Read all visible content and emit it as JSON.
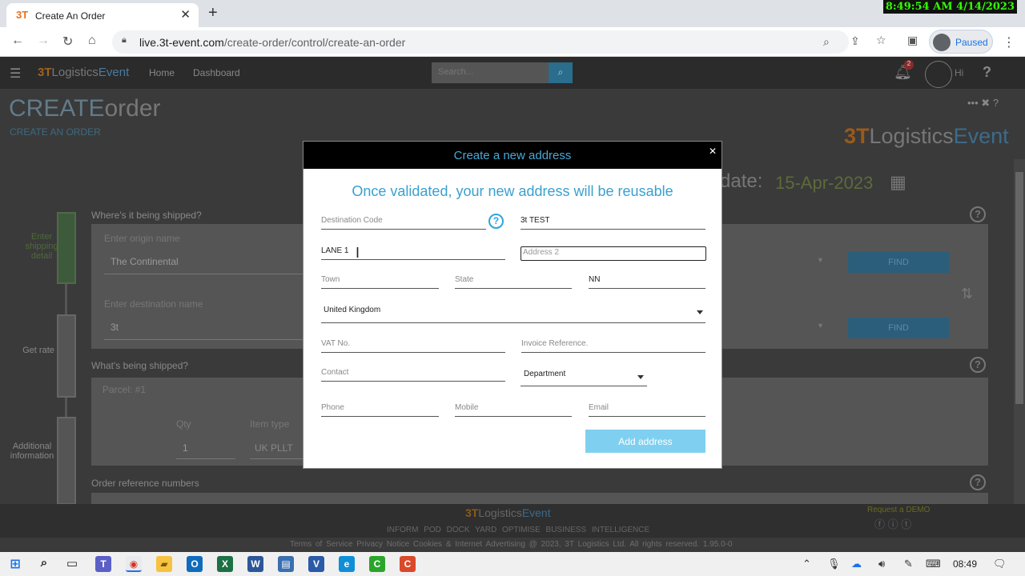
{
  "browser": {
    "tab_title": "Create An Order",
    "tab_favicon": "3T",
    "url_host": "live.3t-event.com",
    "url_path": "/create-order/control/create-an-order",
    "profile_label": "Paused",
    "clock": "8:49:54 AM 4/14/2023"
  },
  "app": {
    "logo": {
      "mark": "3T",
      "word1": "Logistics",
      "word2": "Event"
    },
    "nav": {
      "home": "Home",
      "dashboard": "Dashboard"
    },
    "search_placeholder": "Search...",
    "notification_count": "2",
    "user_greeting": "Hi",
    "page_title_a": "CREATE",
    "page_title_b": "order",
    "page_subtitle": "CREATE AN ORDER",
    "date_label": "date:",
    "date_value": "15-Apr-2023",
    "steps": [
      "Enter shipping detail",
      "Get rate",
      "Additional information"
    ],
    "sections": {
      "shipped_where": "Where's it being shipped?",
      "origin_placeholder": "Enter origin name",
      "origin_value": "The Continental",
      "destination_placeholder": "Enter destination name",
      "destination_value": "3t",
      "find": "FIND",
      "shipped_what": "What's being shipped?",
      "parcel": "Parcel: #1",
      "qty_label": "Qty",
      "qty_value": "1",
      "item_type_label": "Item type",
      "item_type_value": "UK PLLT",
      "order_refs": "Order reference numbers"
    },
    "footer": {
      "links": "INFORM   POD   DOCK   YARD   OPTIMISE   BUSINESS INTELLIGENCE",
      "demo": "Request a DEMO",
      "legal": "Terms of Service   Privacy Notice   Cookies & Internet Advertising   @ 2023, 3T Logistics Ltd. All rights reserved.   1.95.0-0"
    }
  },
  "modal": {
    "title": "Create a new address",
    "subtitle": "Once validated, your new address will be reusable",
    "fields": {
      "destination_code_placeholder": "Destination Code",
      "name_value": "3t TEST",
      "address1_value": "LANE 1",
      "address2_placeholder": "Address 2",
      "town_placeholder": "Town",
      "state_placeholder": "State",
      "postcode_value": "NN",
      "country_value": "United Kingdom",
      "vat_placeholder": "VAT No.",
      "invoice_ref_placeholder": "Invoice Reference.",
      "contact_placeholder": "Contact",
      "department_value": "Department",
      "phone_placeholder": "Phone",
      "mobile_placeholder": "Mobile",
      "email_placeholder": "Email"
    },
    "add_button": "Add address"
  },
  "taskbar": {
    "time": "08:49"
  },
  "colors": {
    "accent": "#3aa0d0",
    "button": "#7fd0f0",
    "header": "#000000"
  }
}
